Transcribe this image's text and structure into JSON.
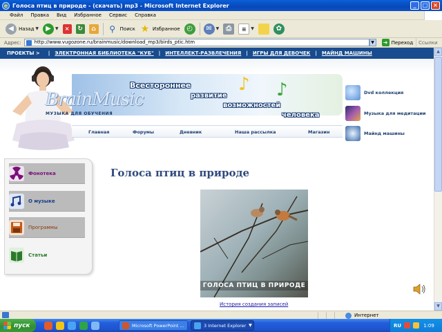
{
  "window": {
    "title": "Голоса птиц в природе - (скачать) mp3 - Microsoft Internet Explorer"
  },
  "menubar": {
    "items": [
      "Файл",
      "Правка",
      "Вид",
      "Избранное",
      "Сервис",
      "Справка"
    ]
  },
  "toolbar": {
    "back_label": "Назад",
    "search_label": "Поиск",
    "favorites_label": "Избранное"
  },
  "addressbar": {
    "label": "Адрес:",
    "url": "http://www.vugozone.ru/brainmusic/download_mp3/birds_ptic.htm",
    "go_label": "Переход",
    "links_label": "Ссылки"
  },
  "page": {
    "projects_label": "ПРОЕКТЫ >",
    "project_links": [
      "ЭЛЕКТРОННАЯ БИБЛИОТЕКА \"КУБ\"",
      "ИНТЕЛЛЕКТ-РАЗВЛЕЧЕНИЯ",
      "ИГРЫ ДЛЯ ДЕВОЧЕК",
      "МАЙНД МАШИНЫ"
    ],
    "brand_name": "BrainMusic",
    "brand_tagline": "МУЗЫКА ДЛЯ ОБУЧЕНИЯ",
    "slogan": [
      "Всестороннее",
      "развитие",
      "возможностей",
      "человека"
    ],
    "nav": [
      "Главная",
      "Форумы",
      "Дневник",
      "Наша рассылка",
      "Магазин"
    ],
    "promos": [
      "Dvd коллекция",
      "Музыка для медитации",
      "Майнд машины"
    ],
    "side_menu": [
      "Фонотека",
      "О музыке",
      "Программы",
      "Статьи"
    ],
    "main_title": "Голоса птиц в природе",
    "album_title": "ГОЛОСА ПТИЦ В ПРИРОДЕ",
    "history_link": "История создания записей"
  },
  "statusbar": {
    "zone": "Интернет"
  },
  "taskbar": {
    "start_label": "пуск",
    "tasks": [
      "Microsoft PowerPoint ...",
      "3 Internet Explorer"
    ],
    "lang": "RU",
    "clock": "1:09"
  },
  "colors": {
    "titlebar": "#0848b8",
    "projects_bar": "#184c8e",
    "taskbar": "#245edb",
    "start_button": "#2f8f2f",
    "side_menu_fonoteka": "#7a0f7a",
    "side_menu_programs": "#8b3a0a",
    "side_menu_articles": "#2b7a2b",
    "main_title": "#2f4a7d"
  }
}
